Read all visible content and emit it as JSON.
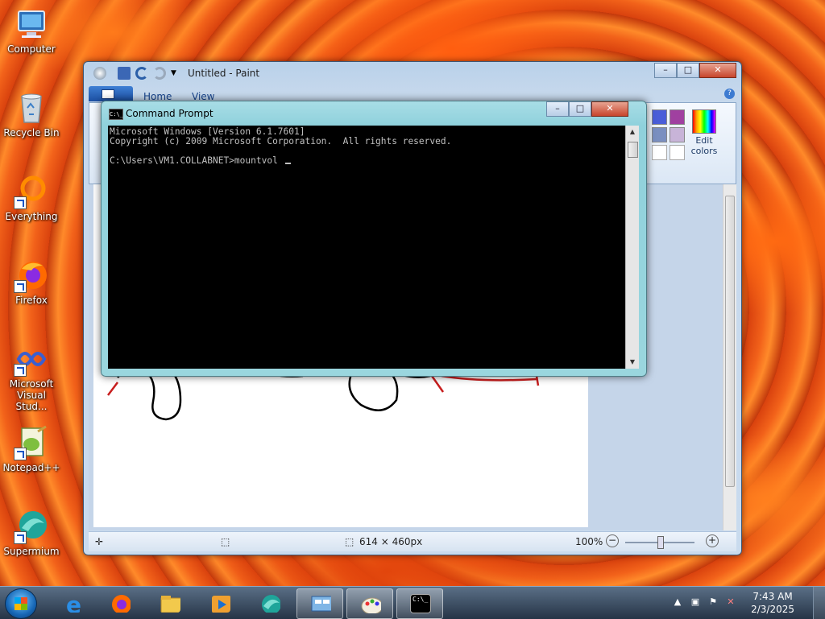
{
  "desktop": {
    "icons": [
      {
        "label": "Computer"
      },
      {
        "label": "Recycle Bin"
      },
      {
        "label": "Everything"
      },
      {
        "label": "Firefox"
      },
      {
        "label": "Microsoft Visual Stud..."
      },
      {
        "label": "Notepad++"
      },
      {
        "label": "Supermium"
      }
    ]
  },
  "paint": {
    "title": "Untitled - Paint",
    "tabs": [
      "Home",
      "View"
    ],
    "edit_colors_label": "Edit colors",
    "status": {
      "image_size": "614 × 460px",
      "zoom": "100%"
    },
    "colors": {
      "purple": "#a040a0",
      "blue": "#4a5ed8",
      "slate": "#7a8fc0",
      "lilac": "#c8b4d8"
    }
  },
  "cmd": {
    "title": "Command Prompt",
    "icon_text": "C:\\_",
    "lines": [
      "Microsoft Windows [Version 6.1.7601]",
      "Copyright (c) 2009 Microsoft Corporation.  All rights reserved.",
      "",
      "C:\\Users\\VM1.COLLABNET>mountvol "
    ]
  },
  "taskbar": {
    "clock_time": "7:43 AM",
    "clock_date": "2/3/2025",
    "cmd_icon_text": "C:\\_"
  }
}
